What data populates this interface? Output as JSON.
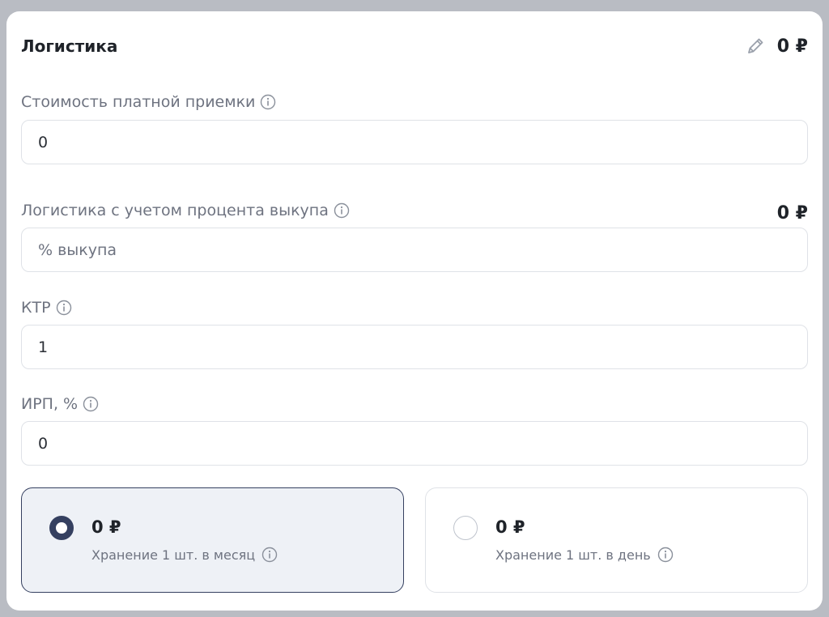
{
  "section": {
    "title": "Логистика",
    "total": "0 ₽"
  },
  "fields": {
    "paid_acceptance": {
      "label": "Стоимость платной приемки",
      "value": "0"
    },
    "logistics_buyout": {
      "label": "Логистика с учетом процента выкупа",
      "amount": "0 ₽",
      "placeholder": "% выкупа"
    },
    "ktr": {
      "label": "КТР",
      "value": "1"
    },
    "irp": {
      "label": "ИРП, %",
      "value": "0"
    }
  },
  "storage": {
    "monthly": {
      "amount": "0 ₽",
      "label": "Хранение 1 шт. в месяц",
      "selected": true
    },
    "daily": {
      "amount": "0 ₽",
      "label": "Хранение 1 шт. в день",
      "selected": false
    }
  },
  "icons": {
    "edit": "pencil-icon",
    "info": "info-icon"
  },
  "colors": {
    "accent": "#354060",
    "selected_bg": "#eef1f6",
    "muted_text": "#6e7380",
    "border": "#dfe2e7"
  }
}
